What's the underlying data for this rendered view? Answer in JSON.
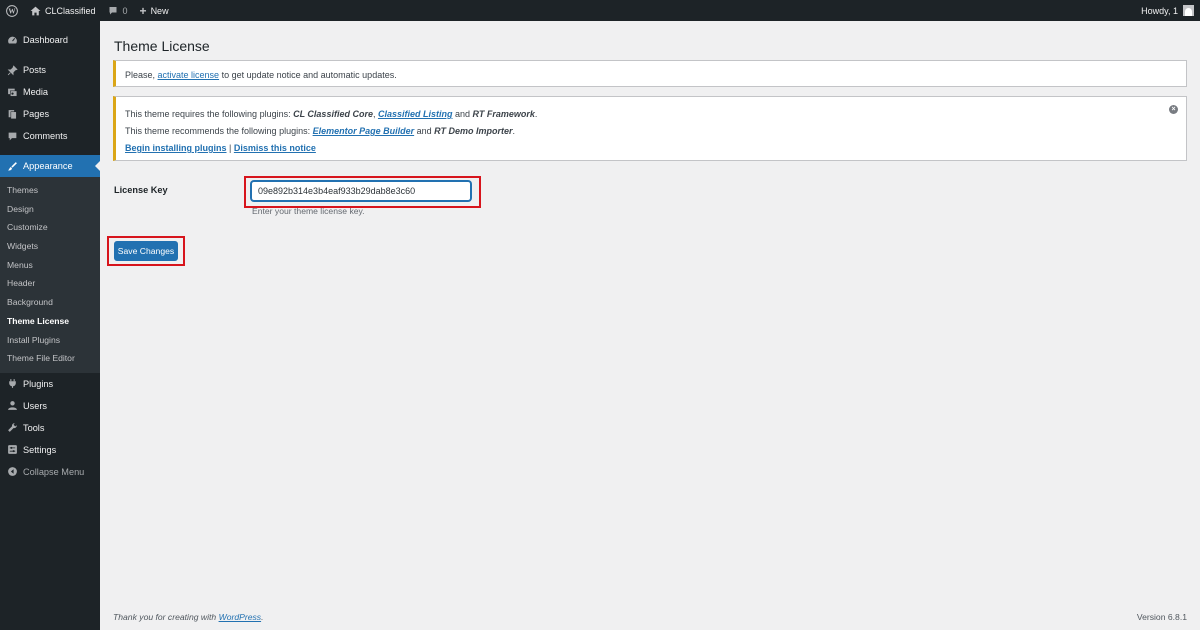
{
  "admin_bar": {
    "site_name": "CLClassified",
    "comments_count": "0",
    "new_label": "New",
    "howdy": "Howdy, 1"
  },
  "sidebar": {
    "items_top": [
      {
        "label": "Dashboard",
        "icon": "dashboard-icon"
      },
      {
        "label": "Posts",
        "icon": "pin-icon"
      },
      {
        "label": "Media",
        "icon": "media-icon"
      },
      {
        "label": "Pages",
        "icon": "pages-icon"
      },
      {
        "label": "Comments",
        "icon": "comment-icon"
      }
    ],
    "appearance": {
      "label": "Appearance",
      "icon": "brush-icon"
    },
    "submenu": [
      "Themes",
      "Design",
      "Customize",
      "Widgets",
      "Menus",
      "Header",
      "Background",
      "Theme License",
      "Install Plugins",
      "Theme File Editor"
    ],
    "submenu_active": "Theme License",
    "items_bottom": [
      {
        "label": "Plugins",
        "icon": "plugin-icon"
      },
      {
        "label": "Users",
        "icon": "users-icon"
      },
      {
        "label": "Tools",
        "icon": "wrench-icon"
      },
      {
        "label": "Settings",
        "icon": "settings-icon"
      }
    ],
    "collapse_label": "Collapse Menu"
  },
  "page": {
    "title": "Theme License",
    "notice1": {
      "prefix": "Please, ",
      "link": "activate license",
      "suffix": " to get update notice and automatic updates."
    },
    "notice2": {
      "req_prefix": "This theme requires the following plugins: ",
      "req_plugin1": "CL Classified Core",
      "req_sep": ", ",
      "req_plugin2": "Classified Listing",
      "req_and": " and ",
      "req_plugin3": "RT Framework",
      "req_end": ".",
      "rec_prefix": "This theme recommends the following plugins: ",
      "rec_plugin1": "Elementor Page Builder",
      "rec_and": " and ",
      "rec_plugin2": "RT Demo Importer",
      "rec_end": ".",
      "begin_link": "Begin installing plugins",
      "divider": " | ",
      "dismiss_link": "Dismiss this notice"
    },
    "license_label": "License Key",
    "license_value": "09e892b314e3b4eaf933b29dab8e3c60",
    "license_hint": "Enter your theme license key.",
    "save_label": "Save Changes"
  },
  "footer": {
    "thanks_prefix": "Thank you for creating with ",
    "thanks_link": "WordPress",
    "thanks_end": ".",
    "version": "Version 6.8.1"
  },
  "colors": {
    "admin_dark": "#1d2327",
    "accent": "#2271b1",
    "warning": "#dba617",
    "highlight": "#d7141c"
  }
}
